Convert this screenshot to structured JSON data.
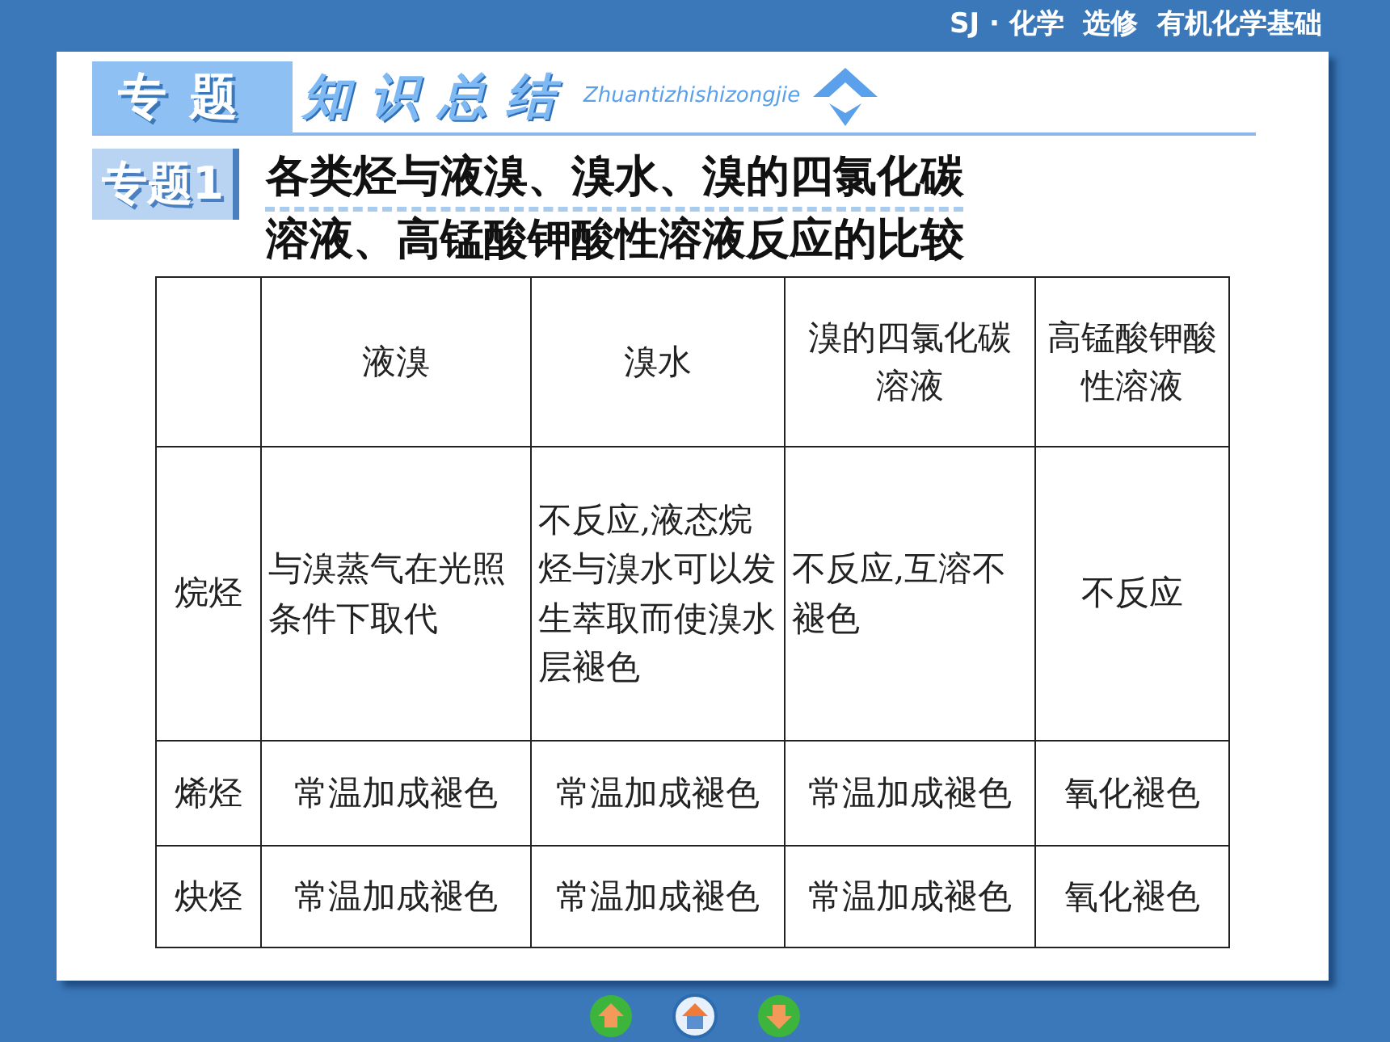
{
  "header": "SJ · 化学  选修  有机化学基础",
  "banner": {
    "tag": "专题",
    "title": "知识总结",
    "pinyin": "Zhuantizhishizongjie"
  },
  "topic": {
    "tag": "专题",
    "number": "1",
    "title_lines": [
      "各类烃与液溴、溴水、溴的四氯化碳",
      "溶液、高锰酸钾酸性溶液反应的比较"
    ]
  },
  "table": {
    "columns": [
      "液溴",
      "溴水",
      "溴的四氯化碳溶液",
      "高锰酸钾酸性溶液"
    ],
    "rows": [
      {
        "label": "烷烃",
        "cells": [
          "与溴蒸气在光照条件下取代",
          "不反应,液态烷烃与溴水可以发生萃取而使溴水层褪色",
          "不反应,互溶不褪色",
          "不反应"
        ]
      },
      {
        "label": "烯烃",
        "cells": [
          "常温加成褪色",
          "常温加成褪色",
          "常温加成褪色",
          "氧化褪色"
        ]
      },
      {
        "label": "炔烃",
        "cells": [
          "常温加成褪色",
          "常温加成褪色",
          "常温加成褪色",
          "氧化褪色"
        ]
      }
    ]
  },
  "nav": [
    {
      "kind": "up"
    },
    {
      "kind": "home"
    },
    {
      "kind": "down"
    }
  ]
}
